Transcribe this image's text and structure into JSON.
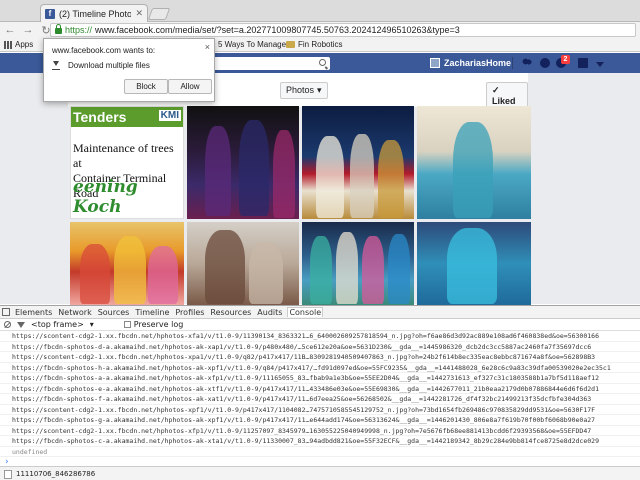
{
  "browser": {
    "tab_title": "(2) Timeline Photos",
    "url_scheme": "https://",
    "url_rest": "www.facebook.com/media/set/?set=a.202771009807745.50763.202412496510263&type=3",
    "bookmarks": [
      {
        "label": "Apps"
      },
      {
        "label": "5 Ways To Manage /"
      },
      {
        "label": "Fin Robotics"
      }
    ]
  },
  "popup": {
    "title": "www.facebook.com wants to:",
    "action": "Download multiple files",
    "block_label": "Block",
    "allow_label": "Allow",
    "close_glyph": "×"
  },
  "fb": {
    "user_name": "Zacharias",
    "home_label": "Home",
    "notif_count": "2",
    "photos_dropdown": "Photos",
    "liked_label": "✓ Liked",
    "brand_color": "#3b5998"
  },
  "photo_news": {
    "header": "Tenders",
    "logo": "KMI",
    "headline_1": "Maintenance of trees at",
    "headline_2": "Container Terminal Road",
    "tagline": "eening Koch"
  },
  "devtools": {
    "tabs": [
      "Elements",
      "Network",
      "Sources",
      "Timeline",
      "Profiles",
      "Resources",
      "Audits",
      "Console"
    ],
    "active_tab": "Console",
    "frame": "<top frame>",
    "preserve_log": "Preserve log",
    "log_lines": [
      "https://scontent-cdg2-1.xx.fbcdn.net/hphotos-xfa1/v/t1.0-9/11390134_8363321…6_6400026092578185​94_n.jpg?oh=f6ae86d3d92ac889e108ad6f460838ed&oe=56300166",
      "https://fbcdn-sphotos-d-a.akamaihd.net/hphotos-ak-xap1/v/t1.0-9/p480x480/…5ce612e20a&oe=5631D230&__gda__=1445986320_dcb2dc3cc5887ac2460fa7f35697dcc6",
      "https://scontent-cdg2-1.xx.fbcdn.net/hphotos-xpa1/v/t1.0-9/q82/p417x417/11B…8309281940509407863_n.jpg?oh=24b2f614b8ec335eac8ebbc871674a8f&oe=562898B3",
      "https://fbcdn-sphotos-h-a.akamaihd.net/hphotos-ak-xpf1/v/t1.0-9/q84/p417x417/…fd91d097ed&oe=55FC9235&__gda__=1441488028_6e28c6c9a83c39dfa0053902​0e2ec35c1",
      "https://fbcdn-sphotos-a-a.akamaihd.net/hphotos-ak-xfp1/v/t1.0-9/11165055_83…fbab9a1e3b&oe=55EE2D04&__gda__=1442731613_ef327c31c1803588b1a7bf5d118aef12",
      "https://fbcdn-sphotos-e-a.akamaihd.net/hphotos-ak-xtf1/v/t1.0-9/p417x417/11…433486e03e&oe=55E69830&__gda__=1442677011_21b0eaa2179d0b07886844e6d6f6d2d1",
      "https://fbcdn-sphotos-f-a.akamaihd.net/hphotos-ak-xat1/v/t1.0-9/p417x417/11…6d7eea25&oe=5626850​2&__gda__=1442281726_df4f32bc21499213f35dcfbfe304d363",
      "https://scontent-cdg2-1.xx.fbcdn.net/hphotos-xpf1/v/t1.0-9/p417x417/1104082…747571058554512​9752_n.jpg?oh=73bd1654fb269486c970835829dd9531&oe=5630F17F",
      "https://fbcdn-sphotos-g-a.akamaihd.net/hphotos-ak-xpf1/v/t1.0-9/p417x417/11…e644add174&oe=56313624&__gda__=1446201430_806e8a7f619b70f00bf6068b90e0a27",
      "https://scontent-cdg2-1.xx.fbcdn.net/hphotos-xfp1/v/t1.0-9/11257097_8345979…1630552250409499​98_n.jpg?oh=7e5676fb68ee881413bcdd6f29393568&oe=55EFDD47",
      "https://fbcdn-sphotos-c-a.akamaihd.net/hphotos-ak-xta1/v/t1.0-9/11330007_83…94adbdd821&oe=55F32ECF&__gda__=1442189342_8b29c284e9bb814fce8725e8d2dce029"
    ],
    "result": "undefined",
    "prompt": "›",
    "drawer_item": "11110706_846286786"
  }
}
